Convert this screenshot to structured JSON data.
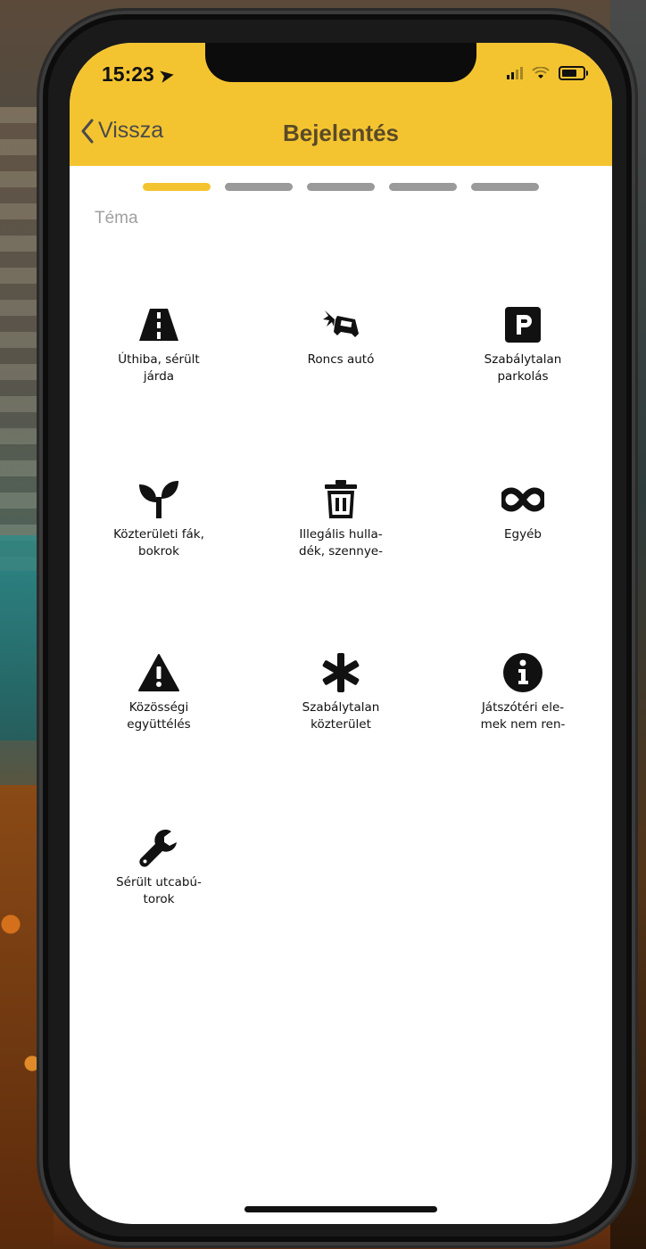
{
  "status_bar": {
    "time": "15:23"
  },
  "header": {
    "back_label": "Vissza",
    "title": "Bejelentés",
    "accent_color": "#f4c430"
  },
  "progress": {
    "total_steps": 5,
    "current_step": 1
  },
  "section": {
    "label": "Téma"
  },
  "categories": [
    {
      "label": "Úthiba, sérült\njárda",
      "icon": "road-icon"
    },
    {
      "label": "Roncs autó",
      "icon": "car-crash-icon"
    },
    {
      "label": "Szabálytalan\nparkolás",
      "icon": "parking-icon"
    },
    {
      "label": "Közterületi fák,\nbokrok",
      "icon": "seedling-icon"
    },
    {
      "label": "Illegális hulla-\ndék, szennye-",
      "icon": "trash-icon"
    },
    {
      "label": "Egyéb",
      "icon": "infinity-icon"
    },
    {
      "label": "Közösségi\negyüttélés",
      "icon": "warning-icon"
    },
    {
      "label": "Szabálytalan\nközterület",
      "icon": "asterisk-icon"
    },
    {
      "label": "Játszótéri ele-\nmek nem ren-",
      "icon": "info-icon"
    },
    {
      "label": "Sérült utcabú-\ntorok",
      "icon": "wrench-icon"
    }
  ]
}
